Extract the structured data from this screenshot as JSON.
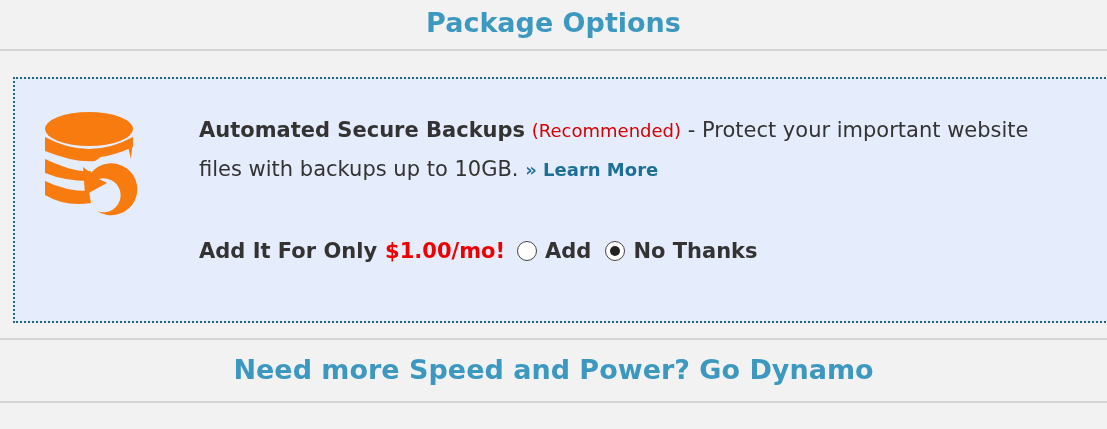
{
  "heading": "Package Options",
  "addon": {
    "title": "Automated Secure Backups",
    "tag": "(Recommended)",
    "description": " - Protect your important website files with backups up to 10GB.",
    "link": "» Learn More",
    "price_label": "Add It For Only",
    "price": "$1.00/mo!",
    "options": [
      {
        "label": "Add",
        "selected": false
      },
      {
        "label": "No Thanks",
        "selected": true
      }
    ]
  },
  "next_heading": "Need more Speed and Power? Go Dynamo"
}
